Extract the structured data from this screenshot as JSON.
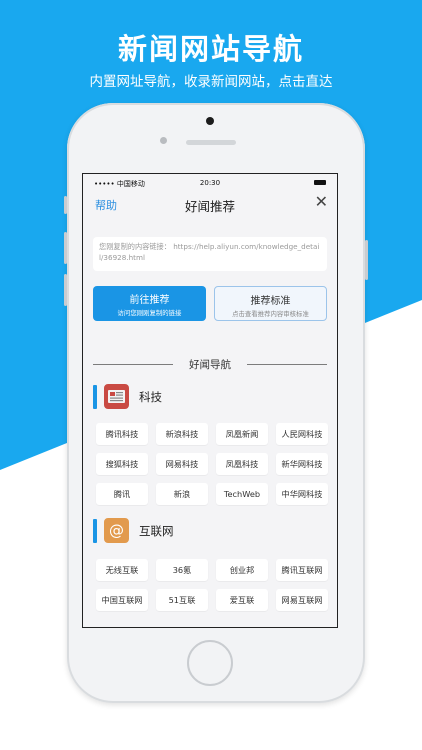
{
  "promo": {
    "headline": "新闻网站导航",
    "subline": "内置网址导航，收录新闻网站，点击直达"
  },
  "status_bar": {
    "carrier": "••••• 中国移动",
    "time": "20:30"
  },
  "nav": {
    "help": "帮助",
    "title": "好闻推荐",
    "close": "✕"
  },
  "link_box": {
    "label": "您刚复制的内容链接：",
    "url": "https://help.aliyun.com/knowledge_detail/36928.html"
  },
  "buttons": {
    "go": {
      "label": "前往推荐",
      "sub": "访问您刚刚复制的链接"
    },
    "standard": {
      "label": "推荐标准",
      "sub": "点击查看推荐内容审核标准"
    }
  },
  "section_title": "好闻导航",
  "categories": [
    {
      "label": "科技",
      "icon": "newspaper-icon",
      "items": [
        "腾讯科技",
        "新浪科技",
        "凤凰新闻",
        "人民网科技",
        "搜狐科技",
        "网易科技",
        "凤凰科技",
        "新华网科技",
        "腾讯",
        "新浪",
        "TechWeb",
        "中华网科技"
      ]
    },
    {
      "label": "互联网",
      "icon": "at-sign-icon",
      "items": [
        "无线互联",
        "36氪",
        "创业邦",
        "腾讯互联网",
        "中国互联网",
        "51互联",
        "爱互联",
        "网易互联网"
      ]
    }
  ],
  "colors": {
    "background_blue": "#19a8ef",
    "accent_blue": "#1a95e5",
    "tech_icon": "#c94a43",
    "internet_icon": "#e29a4d"
  }
}
